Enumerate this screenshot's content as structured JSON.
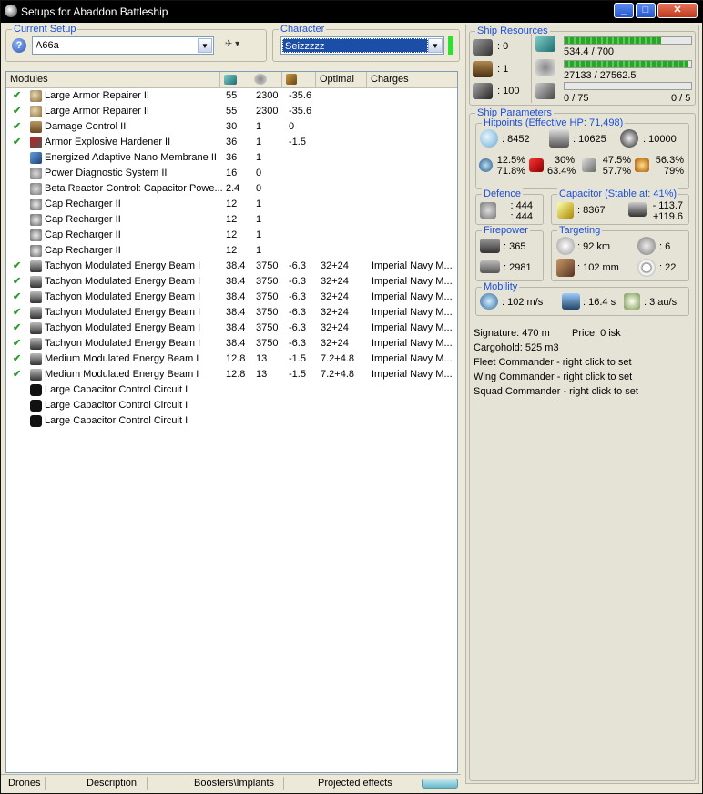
{
  "window": {
    "title": "Setups for Abaddon Battleship"
  },
  "setup": {
    "legend": "Current Setup",
    "value": "A66a"
  },
  "character": {
    "legend": "Character",
    "value": "Seizzzzz"
  },
  "modules": {
    "headers": [
      "Modules",
      "",
      "",
      "",
      "Optimal",
      "Charges"
    ],
    "rows": [
      {
        "checked": true,
        "icon": "armor-repairer-icon",
        "name": "Large Armor Repairer II",
        "c1": "55",
        "c2": "2300",
        "c3": "-35.6",
        "c4": "",
        "c5": ""
      },
      {
        "checked": true,
        "icon": "armor-repairer-icon",
        "name": "Large Armor Repairer II",
        "c1": "55",
        "c2": "2300",
        "c3": "-35.6",
        "c4": "",
        "c5": ""
      },
      {
        "checked": true,
        "icon": "damage-control-icon",
        "name": "Damage Control II",
        "c1": "30",
        "c2": "1",
        "c3": "0",
        "c4": "",
        "c5": ""
      },
      {
        "checked": true,
        "icon": "hardener-icon",
        "name": "Armor Explosive Hardener II",
        "c1": "36",
        "c2": "1",
        "c3": "-1.5",
        "c4": "",
        "c5": ""
      },
      {
        "checked": false,
        "icon": "nano-membrane-icon",
        "name": "Energized Adaptive Nano Membrane II",
        "c1": "36",
        "c2": "1",
        "c3": "",
        "c4": "",
        "c5": ""
      },
      {
        "checked": false,
        "icon": "power-diagnostic-icon",
        "name": "Power Diagnostic System II",
        "c1": "16",
        "c2": "0",
        "c3": "",
        "c4": "",
        "c5": ""
      },
      {
        "checked": false,
        "icon": "reactor-control-icon",
        "name": "Beta Reactor Control: Capacitor Powe...",
        "c1": "2.4",
        "c2": "0",
        "c3": "",
        "c4": "",
        "c5": ""
      },
      {
        "checked": false,
        "icon": "cap-recharger-icon",
        "name": "Cap Recharger II",
        "c1": "12",
        "c2": "1",
        "c3": "",
        "c4": "",
        "c5": ""
      },
      {
        "checked": false,
        "icon": "cap-recharger-icon",
        "name": "Cap Recharger II",
        "c1": "12",
        "c2": "1",
        "c3": "",
        "c4": "",
        "c5": ""
      },
      {
        "checked": false,
        "icon": "cap-recharger-icon",
        "name": "Cap Recharger II",
        "c1": "12",
        "c2": "1",
        "c3": "",
        "c4": "",
        "c5": ""
      },
      {
        "checked": false,
        "icon": "cap-recharger-icon",
        "name": "Cap Recharger II",
        "c1": "12",
        "c2": "1",
        "c3": "",
        "c4": "",
        "c5": ""
      },
      {
        "checked": true,
        "icon": "energy-beam-icon",
        "name": "Tachyon Modulated Energy Beam I",
        "c1": "38.4",
        "c2": "3750",
        "c3": "-6.3",
        "c4": "32+24",
        "c5": "Imperial Navy M..."
      },
      {
        "checked": true,
        "icon": "energy-beam-icon",
        "name": "Tachyon Modulated Energy Beam I",
        "c1": "38.4",
        "c2": "3750",
        "c3": "-6.3",
        "c4": "32+24",
        "c5": "Imperial Navy M..."
      },
      {
        "checked": true,
        "icon": "energy-beam-icon",
        "name": "Tachyon Modulated Energy Beam I",
        "c1": "38.4",
        "c2": "3750",
        "c3": "-6.3",
        "c4": "32+24",
        "c5": "Imperial Navy M..."
      },
      {
        "checked": true,
        "icon": "energy-beam-icon",
        "name": "Tachyon Modulated Energy Beam I",
        "c1": "38.4",
        "c2": "3750",
        "c3": "-6.3",
        "c4": "32+24",
        "c5": "Imperial Navy M..."
      },
      {
        "checked": true,
        "icon": "energy-beam-icon",
        "name": "Tachyon Modulated Energy Beam I",
        "c1": "38.4",
        "c2": "3750",
        "c3": "-6.3",
        "c4": "32+24",
        "c5": "Imperial Navy M..."
      },
      {
        "checked": true,
        "icon": "energy-beam-icon",
        "name": "Tachyon Modulated Energy Beam I",
        "c1": "38.4",
        "c2": "3750",
        "c3": "-6.3",
        "c4": "32+24",
        "c5": "Imperial Navy M..."
      },
      {
        "checked": true,
        "icon": "medium-beam-icon",
        "name": "Medium Modulated Energy Beam I",
        "c1": "12.8",
        "c2": "13",
        "c3": "-1.5",
        "c4": "7.2+4.8",
        "c5": "Imperial Navy M..."
      },
      {
        "checked": true,
        "icon": "medium-beam-icon",
        "name": "Medium Modulated Energy Beam I",
        "c1": "12.8",
        "c2": "13",
        "c3": "-1.5",
        "c4": "7.2+4.8",
        "c5": "Imperial Navy M..."
      },
      {
        "checked": false,
        "icon": "rig-icon",
        "name": "Large Capacitor Control Circuit I",
        "c1": "",
        "c2": "",
        "c3": "",
        "c4": "",
        "c5": ""
      },
      {
        "checked": false,
        "icon": "rig-icon",
        "name": "Large Capacitor Control Circuit I",
        "c1": "",
        "c2": "",
        "c3": "",
        "c4": "",
        "c5": ""
      },
      {
        "checked": false,
        "icon": "rig-icon",
        "name": "Large Capacitor Control Circuit I",
        "c1": "",
        "c2": "",
        "c3": "",
        "c4": "",
        "c5": ""
      }
    ]
  },
  "tabs": [
    "Drones",
    "Description",
    "Boosters\\Implants",
    "Projected effects"
  ],
  "resources": {
    "legend": "Ship Resources",
    "turret_hardpoints": ": 0",
    "launcher_hardpoints": ": 1",
    "calibration": ": 100",
    "cpu": "534.4 / 700",
    "cpu_level": 0.76,
    "powergrid": "27133 / 27562.5",
    "powergrid_level": 0.98,
    "drone_bay": "0 / 75",
    "drone_bandwidth": "0 / 5",
    "drone_level": 0.0
  },
  "params": {
    "legend": "Ship Parameters",
    "hitpoints": {
      "legend": "Hitpoints (Effective HP: 71,498)",
      "shield": ": 8452",
      "armor": ": 10625",
      "structure": ": 10000",
      "em": [
        "12.5%",
        "71.8%"
      ],
      "thermal": [
        "30%",
        "63.4%"
      ],
      "kinetic": [
        "47.5%",
        "57.7%"
      ],
      "explosive": [
        "56.3%",
        "79%"
      ]
    },
    "defence": {
      "legend": "Defence",
      "a": ": 444",
      "b": ": 444"
    },
    "capacitor": {
      "legend": "Capacitor (Stable at: 41%)",
      "amount": ": 8367",
      "use": "- 113.7",
      "recharge": "+119.6"
    },
    "firepower": {
      "legend": "Firepower",
      "dps": ": 365",
      "volley": ": 2981"
    },
    "targeting": {
      "legend": "Targeting",
      "range": ": 92 km",
      "targets": ": 6",
      "resolution": ": 102 mm",
      "sensor": ": 22"
    },
    "mobility": {
      "legend": "Mobility",
      "speed": ": 102 m/s",
      "align": ": 16.4 s",
      "warp": ": 3 au/s"
    },
    "signature": "Signature: 470 m",
    "price": "Price: 0 isk",
    "cargohold": "Cargohold: 525 m3",
    "fleet_commander": "Fleet Commander - right click to set",
    "wing_commander": "Wing Commander - right click to set",
    "squad_commander": "Squad Commander - right click to set"
  },
  "colors": {
    "legend": "#1c4ed8",
    "check": "#2e9a2e",
    "bar_fill": "#2aa52a",
    "character_bg": "#1c4ea8"
  }
}
